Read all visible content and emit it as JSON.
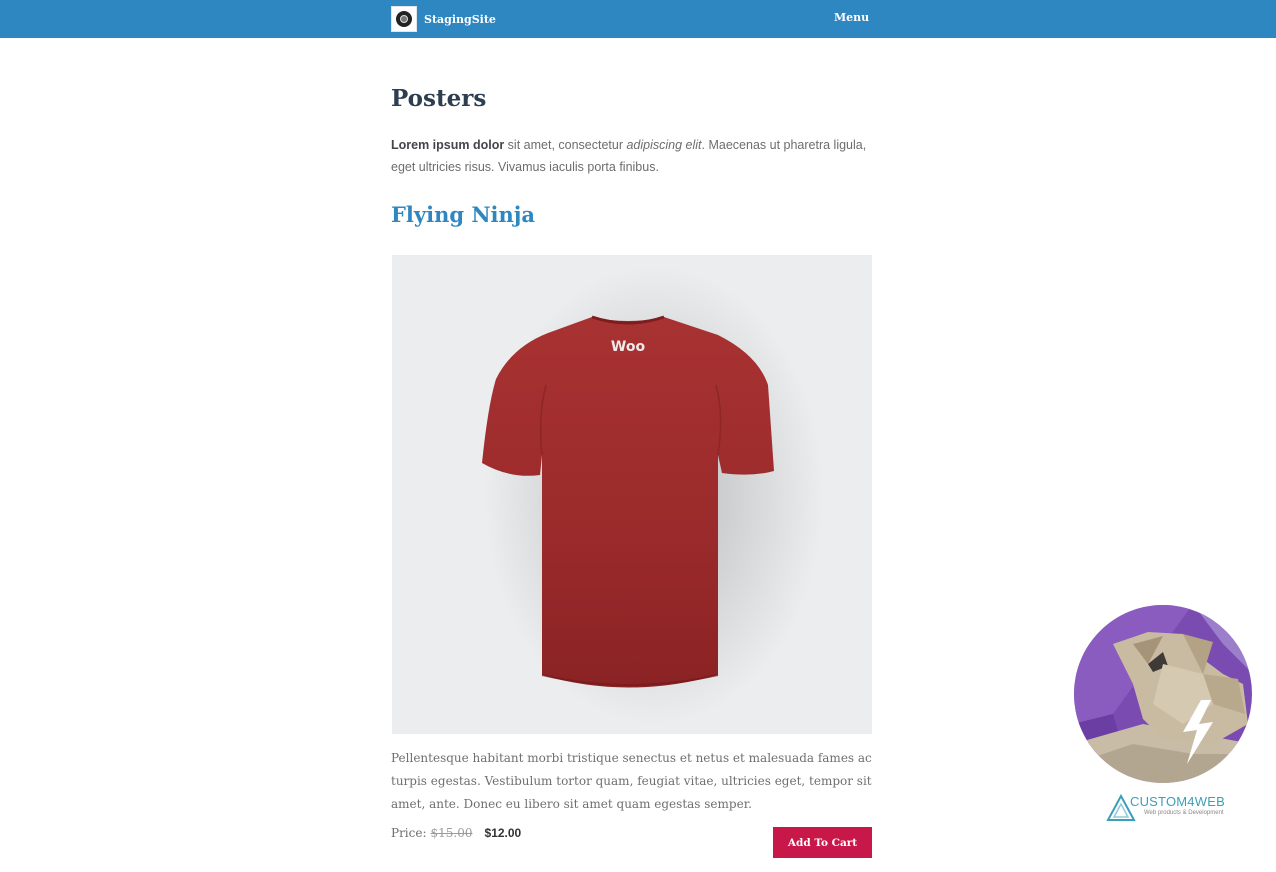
{
  "header": {
    "site_name": "StagingSite",
    "menu_label": "Menu",
    "bar_color": "#2f87c1"
  },
  "page": {
    "title": "Posters",
    "intro_bold": "Lorem ipsum dolor",
    "intro_plain_1": " sit amet, consectetur ",
    "intro_italic": "adipiscing elit",
    "intro_plain_2": ". Maecenas ut pharetra ligula, eget ultricies risus. Vivamus iaculis porta finibus."
  },
  "product": {
    "title": "Flying Ninja",
    "image_icon": "red-tshirt-back-image",
    "shirt_print": "Woo",
    "description": "Pellentesque habitant morbi tristique senectus et netus et malesuada fames ac turpis egestas. Vestibulum tortor quam, feugiat vitae, ultricies eget, tempor sit amet, ante. Donec eu libero sit amet quam egestas semper.",
    "price_label": "Price:",
    "regular_price": "$15.00",
    "sale_price": "$12.00",
    "add_to_cart_label": "Add To Cart",
    "button_color": "#c8184a"
  },
  "branding": {
    "badge_icon": "custom4web-lowpoly-badge",
    "company_name": "CUSTOM4WEB",
    "company_tagline": "Web products & Development"
  }
}
